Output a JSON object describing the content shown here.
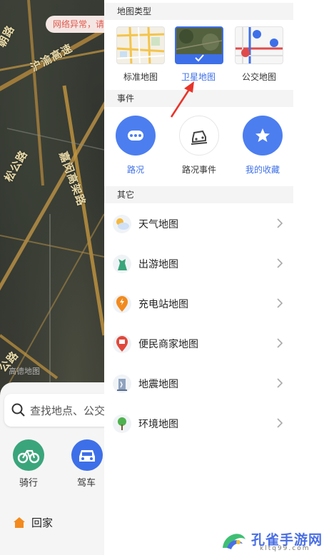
{
  "map": {
    "network_warning": "网络异常，请",
    "road_labels": [
      "沪渝高速",
      "嘉闵高架路",
      "松公路",
      "公路",
      "朝路"
    ],
    "watermark": "高德地图"
  },
  "bottom_card": {
    "search_placeholder": "查找地点、公交",
    "quick_actions": [
      {
        "label": "骑行",
        "icon": "bike-icon",
        "color": "#3aa57b"
      },
      {
        "label": "驾车",
        "icon": "car-icon",
        "color": "#3d6fe8"
      }
    ],
    "home_label": "回家"
  },
  "panel": {
    "map_type_title": "地图类型",
    "map_types": [
      {
        "label": "标准地图",
        "selected": false
      },
      {
        "label": "卫星地图",
        "selected": true
      },
      {
        "label": "公交地图",
        "selected": false
      }
    ],
    "events_title": "事件",
    "events": [
      {
        "label": "路况",
        "icon": "traffic-icon",
        "active": true
      },
      {
        "label": "路况事件",
        "icon": "road-event-icon",
        "active": false
      },
      {
        "label": "我的收藏",
        "icon": "star-icon",
        "active": true
      }
    ],
    "other_title": "其它",
    "others": [
      {
        "label": "天气地图",
        "icon": "weather-icon"
      },
      {
        "label": "出游地图",
        "icon": "travel-icon"
      },
      {
        "label": "充电站地图",
        "icon": "charging-icon"
      },
      {
        "label": "便民商家地图",
        "icon": "shop-icon"
      },
      {
        "label": "地震地图",
        "icon": "earthquake-icon"
      },
      {
        "label": "环境地图",
        "icon": "environment-icon"
      }
    ]
  },
  "watermark_logo": {
    "title": "孔雀手游网",
    "url": "kltq99.com"
  },
  "colors": {
    "accent": "#3d6fe8",
    "annotation_arrow": "#e8342a"
  }
}
